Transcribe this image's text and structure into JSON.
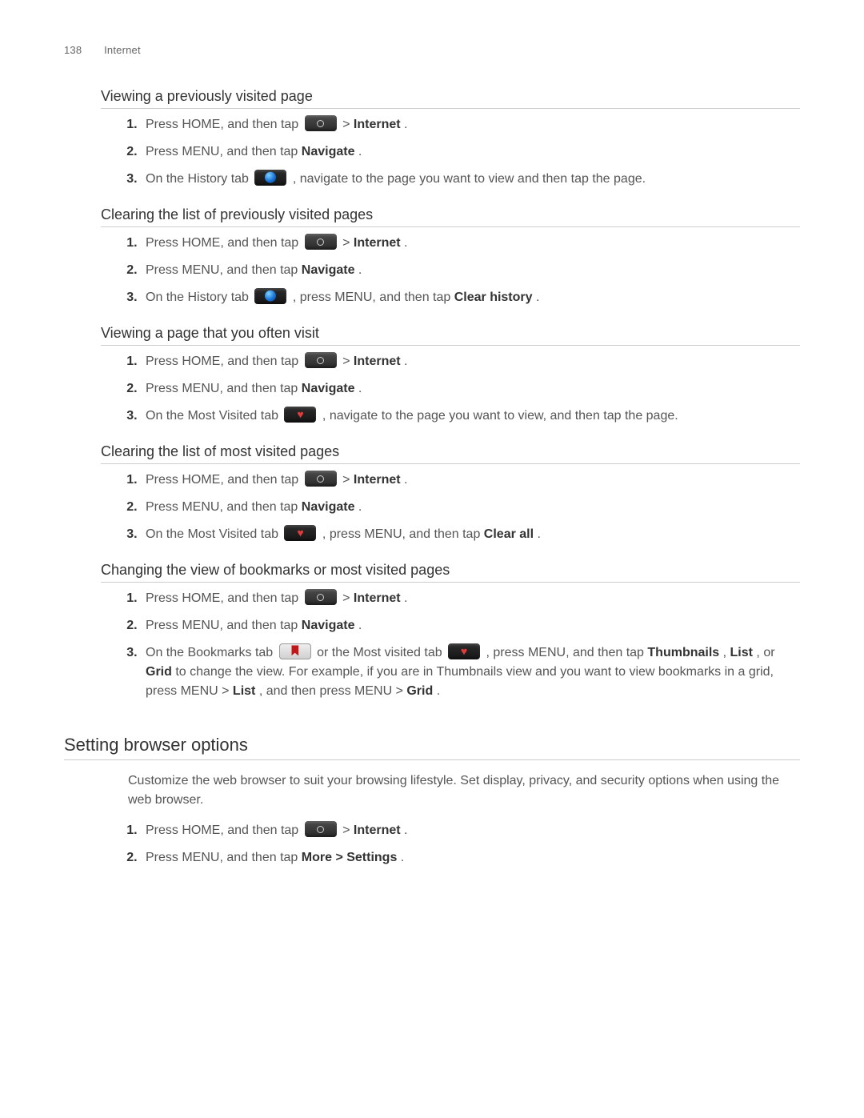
{
  "header": {
    "page_number": "138",
    "chapter": "Internet"
  },
  "sections": [
    {
      "heading": "Viewing a previously visited page",
      "steps": {
        "s1a": "Press HOME, and then tap ",
        "s1b": " > ",
        "s1c": "Internet",
        "s1d": ".",
        "s2a": "Press MENU, and then tap ",
        "s2b": "Navigate",
        "s2c": ".",
        "s3a": "On the History tab ",
        "s3b": ", navigate to the page you want to view and then tap the page."
      }
    },
    {
      "heading": "Clearing the list of previously visited pages",
      "steps": {
        "s1a": "Press HOME, and then tap ",
        "s1b": " > ",
        "s1c": "Internet",
        "s1d": ".",
        "s2a": "Press MENU, and then tap ",
        "s2b": "Navigate",
        "s2c": ".",
        "s3a": "On the History tab ",
        "s3b": ", press MENU, and then tap ",
        "s3c": "Clear history",
        "s3d": "."
      }
    },
    {
      "heading": "Viewing a page that you often visit",
      "steps": {
        "s1a": "Press HOME, and then tap ",
        "s1b": " > ",
        "s1c": "Internet",
        "s1d": ".",
        "s2a": "Press MENU, and then tap ",
        "s2b": "Navigate",
        "s2c": ".",
        "s3a": "On the Most Visited tab ",
        "s3b": ", navigate to the page you want to view, and then tap the page."
      }
    },
    {
      "heading": "Clearing the list of most visited pages",
      "steps": {
        "s1a": "Press HOME, and then tap ",
        "s1b": " > ",
        "s1c": "Internet",
        "s1d": ".",
        "s2a": "Press MENU, and then tap ",
        "s2b": "Navigate",
        "s2c": ".",
        "s3a": "On the Most Visited tab ",
        "s3b": ", press MENU, and then tap ",
        "s3c": "Clear all",
        "s3d": "."
      }
    },
    {
      "heading": "Changing the view of bookmarks or most visited pages",
      "steps": {
        "s1a": "Press HOME, and then tap ",
        "s1b": " > ",
        "s1c": "Internet",
        "s1d": ".",
        "s2a": "Press MENU, and then tap ",
        "s2b": "Navigate",
        "s2c": ".",
        "s3a": "On the Bookmarks tab ",
        "s3b": " or the Most visited tab ",
        "s3c": ", press MENU, and then tap ",
        "s3d": "Thumbnails",
        "s3e": ", ",
        "s3f": "List",
        "s3g": ", or ",
        "s3h": "Grid",
        "s3i": " to change the view. For example, if you are in Thumbnails view and you want to view bookmarks in a grid, press MENU > ",
        "s3j": "List",
        "s3k": ", and then press MENU > ",
        "s3l": "Grid",
        "s3m": "."
      }
    }
  ],
  "setting_options": {
    "heading": "Setting browser options",
    "intro": "Customize the web browser to suit your browsing lifestyle. Set display, privacy, and security options when using the web browser.",
    "steps": {
      "s1a": "Press HOME, and then tap ",
      "s1b": " > ",
      "s1c": "Internet",
      "s1d": ".",
      "s2a": "Press MENU, and then tap ",
      "s2b": "More > Settings",
      "s2c": "."
    }
  }
}
